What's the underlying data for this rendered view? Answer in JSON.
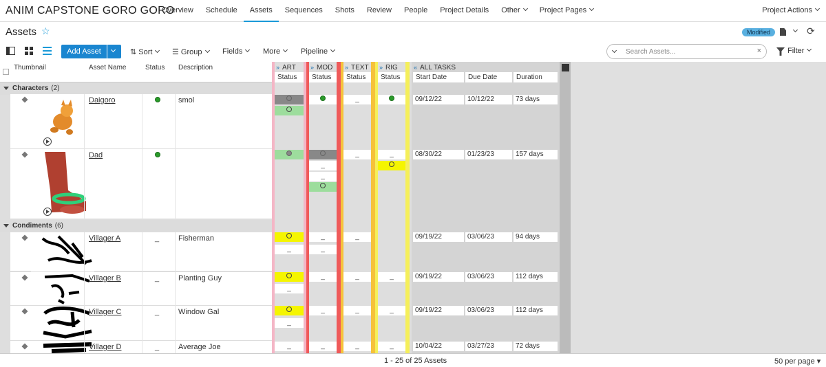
{
  "project_title": "ANIM CAPSTONE GORO GORO",
  "nav": [
    "Overview",
    "Schedule",
    "Assets",
    "Sequences",
    "Shots",
    "Review",
    "People",
    "Project Details",
    "Other",
    "Project Pages"
  ],
  "nav_active": "Assets",
  "project_actions": "Project Actions",
  "page_title": "Assets",
  "modified_badge": "Modified",
  "toolbar": {
    "add_asset": "Add Asset",
    "sort": "Sort",
    "group": "Group",
    "fields": "Fields",
    "more": "More",
    "pipeline": "Pipeline",
    "search_placeholder": "Search Assets...",
    "filter": "Filter",
    "clear": "×"
  },
  "columns": {
    "thumbnail": "Thumbnail",
    "asset_name": "Asset Name",
    "status": "Status",
    "description": "Description"
  },
  "pipeline_steps": [
    {
      "name": "ART",
      "sub": "Status",
      "color": "#f4b6c6"
    },
    {
      "name": "MOD",
      "sub": "Status",
      "color": "#ef5a5a"
    },
    {
      "name": "TEXT",
      "sub": "Status",
      "color": "#f6c23a"
    },
    {
      "name": "RIG",
      "sub": "Status",
      "color": "#f5ef5a"
    }
  ],
  "all_tasks": {
    "label": "ALL TASKS",
    "start": "Start Date",
    "due": "Due Date",
    "duration": "Duration"
  },
  "groups": [
    {
      "name": "Characters",
      "count": "(2)"
    },
    {
      "name": "Condiments",
      "count": "(6)"
    }
  ],
  "assets": [
    {
      "name": "Daigoro",
      "status": "green",
      "description": "smol",
      "start": "09/12/22",
      "due": "10/12/22",
      "duration": "73 days"
    },
    {
      "name": "Dad",
      "status": "green",
      "description": "",
      "start": "08/30/22",
      "due": "01/23/23",
      "duration": "157 days"
    },
    {
      "name": "Villager A",
      "status": "-",
      "description": "Fisherman",
      "start": "09/19/22",
      "due": "03/06/23",
      "duration": "94 days"
    },
    {
      "name": "Villager B",
      "status": "-",
      "description": "Planting Guy",
      "start": "09/19/22",
      "due": "03/06/23",
      "duration": "112 days"
    },
    {
      "name": "Villager C",
      "status": "-",
      "description": "Window Gal",
      "start": "09/19/22",
      "due": "03/06/23",
      "duration": "112 days"
    },
    {
      "name": "Villager D",
      "status": "-",
      "description": "Average Joe",
      "start": "10/04/22",
      "due": "03/27/23",
      "duration": "72 days"
    }
  ],
  "dash": "_",
  "footer": {
    "page_info": "1 - 25 of 25 Assets",
    "per_page": "50 per page"
  }
}
